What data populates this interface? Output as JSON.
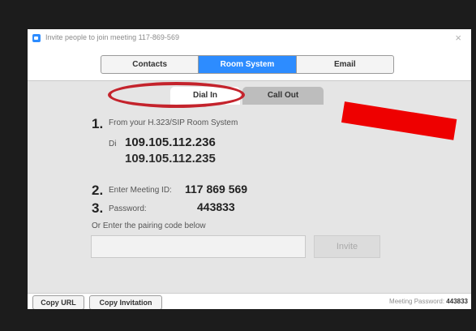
{
  "window": {
    "title": "Invite people to join meeting 117-869-569",
    "close_glyph": "×"
  },
  "tabs": [
    "Contacts",
    "Room System",
    "Email"
  ],
  "active_tab": "Room System",
  "subtabs": {
    "dial_in": "Dial In",
    "call_out": "Call Out",
    "active": "Dial In"
  },
  "steps": {
    "s1": {
      "num": "1.",
      "text": "From your H.323/SIP Room System",
      "dial_prefix": "Di",
      "ip1": "109.105.112.236",
      "ip2": "109.105.112.235"
    },
    "s2": {
      "num": "2.",
      "text": "Enter Meeting ID:",
      "meeting_id": "117 869 569"
    },
    "s3": {
      "num": "3.",
      "text": "Password:",
      "password": "443833"
    }
  },
  "pairing": {
    "label": "Or Enter the pairing code below",
    "input_value": "",
    "invite_label": "Invite"
  },
  "footer": {
    "copy_url": "Copy URL",
    "copy_invitation": "Copy Invitation",
    "meeting_password_label": "Meeting Password:",
    "meeting_password_value": "443833"
  },
  "colors": {
    "accent": "#2d8cff",
    "annotation_red": "#ee0000",
    "oval_red": "#c4232c"
  }
}
